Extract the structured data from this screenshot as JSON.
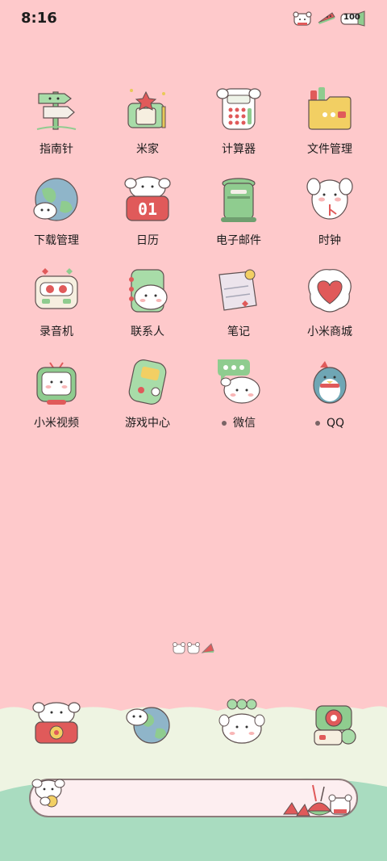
{
  "status_bar": {
    "time": "8:16",
    "battery": "100"
  },
  "apps": [
    {
      "label": "指南针",
      "icon": "compass-signpost-icon",
      "dot": false
    },
    {
      "label": "米家",
      "icon": "smart-home-icon",
      "dot": false
    },
    {
      "label": "计算器",
      "icon": "calculator-icon",
      "dot": false
    },
    {
      "label": "文件管理",
      "icon": "folder-icon",
      "dot": false
    },
    {
      "label": "下载管理",
      "icon": "download-globe-icon",
      "dot": false
    },
    {
      "label": "日历",
      "icon": "calendar-icon",
      "dot": false,
      "badge": "01"
    },
    {
      "label": "电子邮件",
      "icon": "mailbox-icon",
      "dot": false
    },
    {
      "label": "时钟",
      "icon": "clock-icon",
      "dot": false
    },
    {
      "label": "录音机",
      "icon": "recorder-icon",
      "dot": false
    },
    {
      "label": "联系人",
      "icon": "contacts-icon",
      "dot": false
    },
    {
      "label": "笔记",
      "icon": "notes-icon",
      "dot": false
    },
    {
      "label": "小米商城",
      "icon": "heart-shop-icon",
      "dot": false
    },
    {
      "label": "小米视频",
      "icon": "tv-icon",
      "dot": false
    },
    {
      "label": "游戏中心",
      "icon": "gamepad-icon",
      "dot": false
    },
    {
      "label": "微信",
      "icon": "wechat-bubble-icon",
      "dot": true
    },
    {
      "label": "QQ",
      "icon": "penguin-icon",
      "dot": true
    }
  ],
  "dock": [
    {
      "icon": "phone-icon"
    },
    {
      "icon": "browser-globe-icon"
    },
    {
      "icon": "messages-icon"
    },
    {
      "icon": "camera-icon"
    }
  ],
  "colors": {
    "background": "#fec9cb",
    "dock_cream": "#eef4e2",
    "dock_mint": "#a9dcc0",
    "accent_red": "#e05a5a",
    "accent_green": "#8fcc8f"
  }
}
